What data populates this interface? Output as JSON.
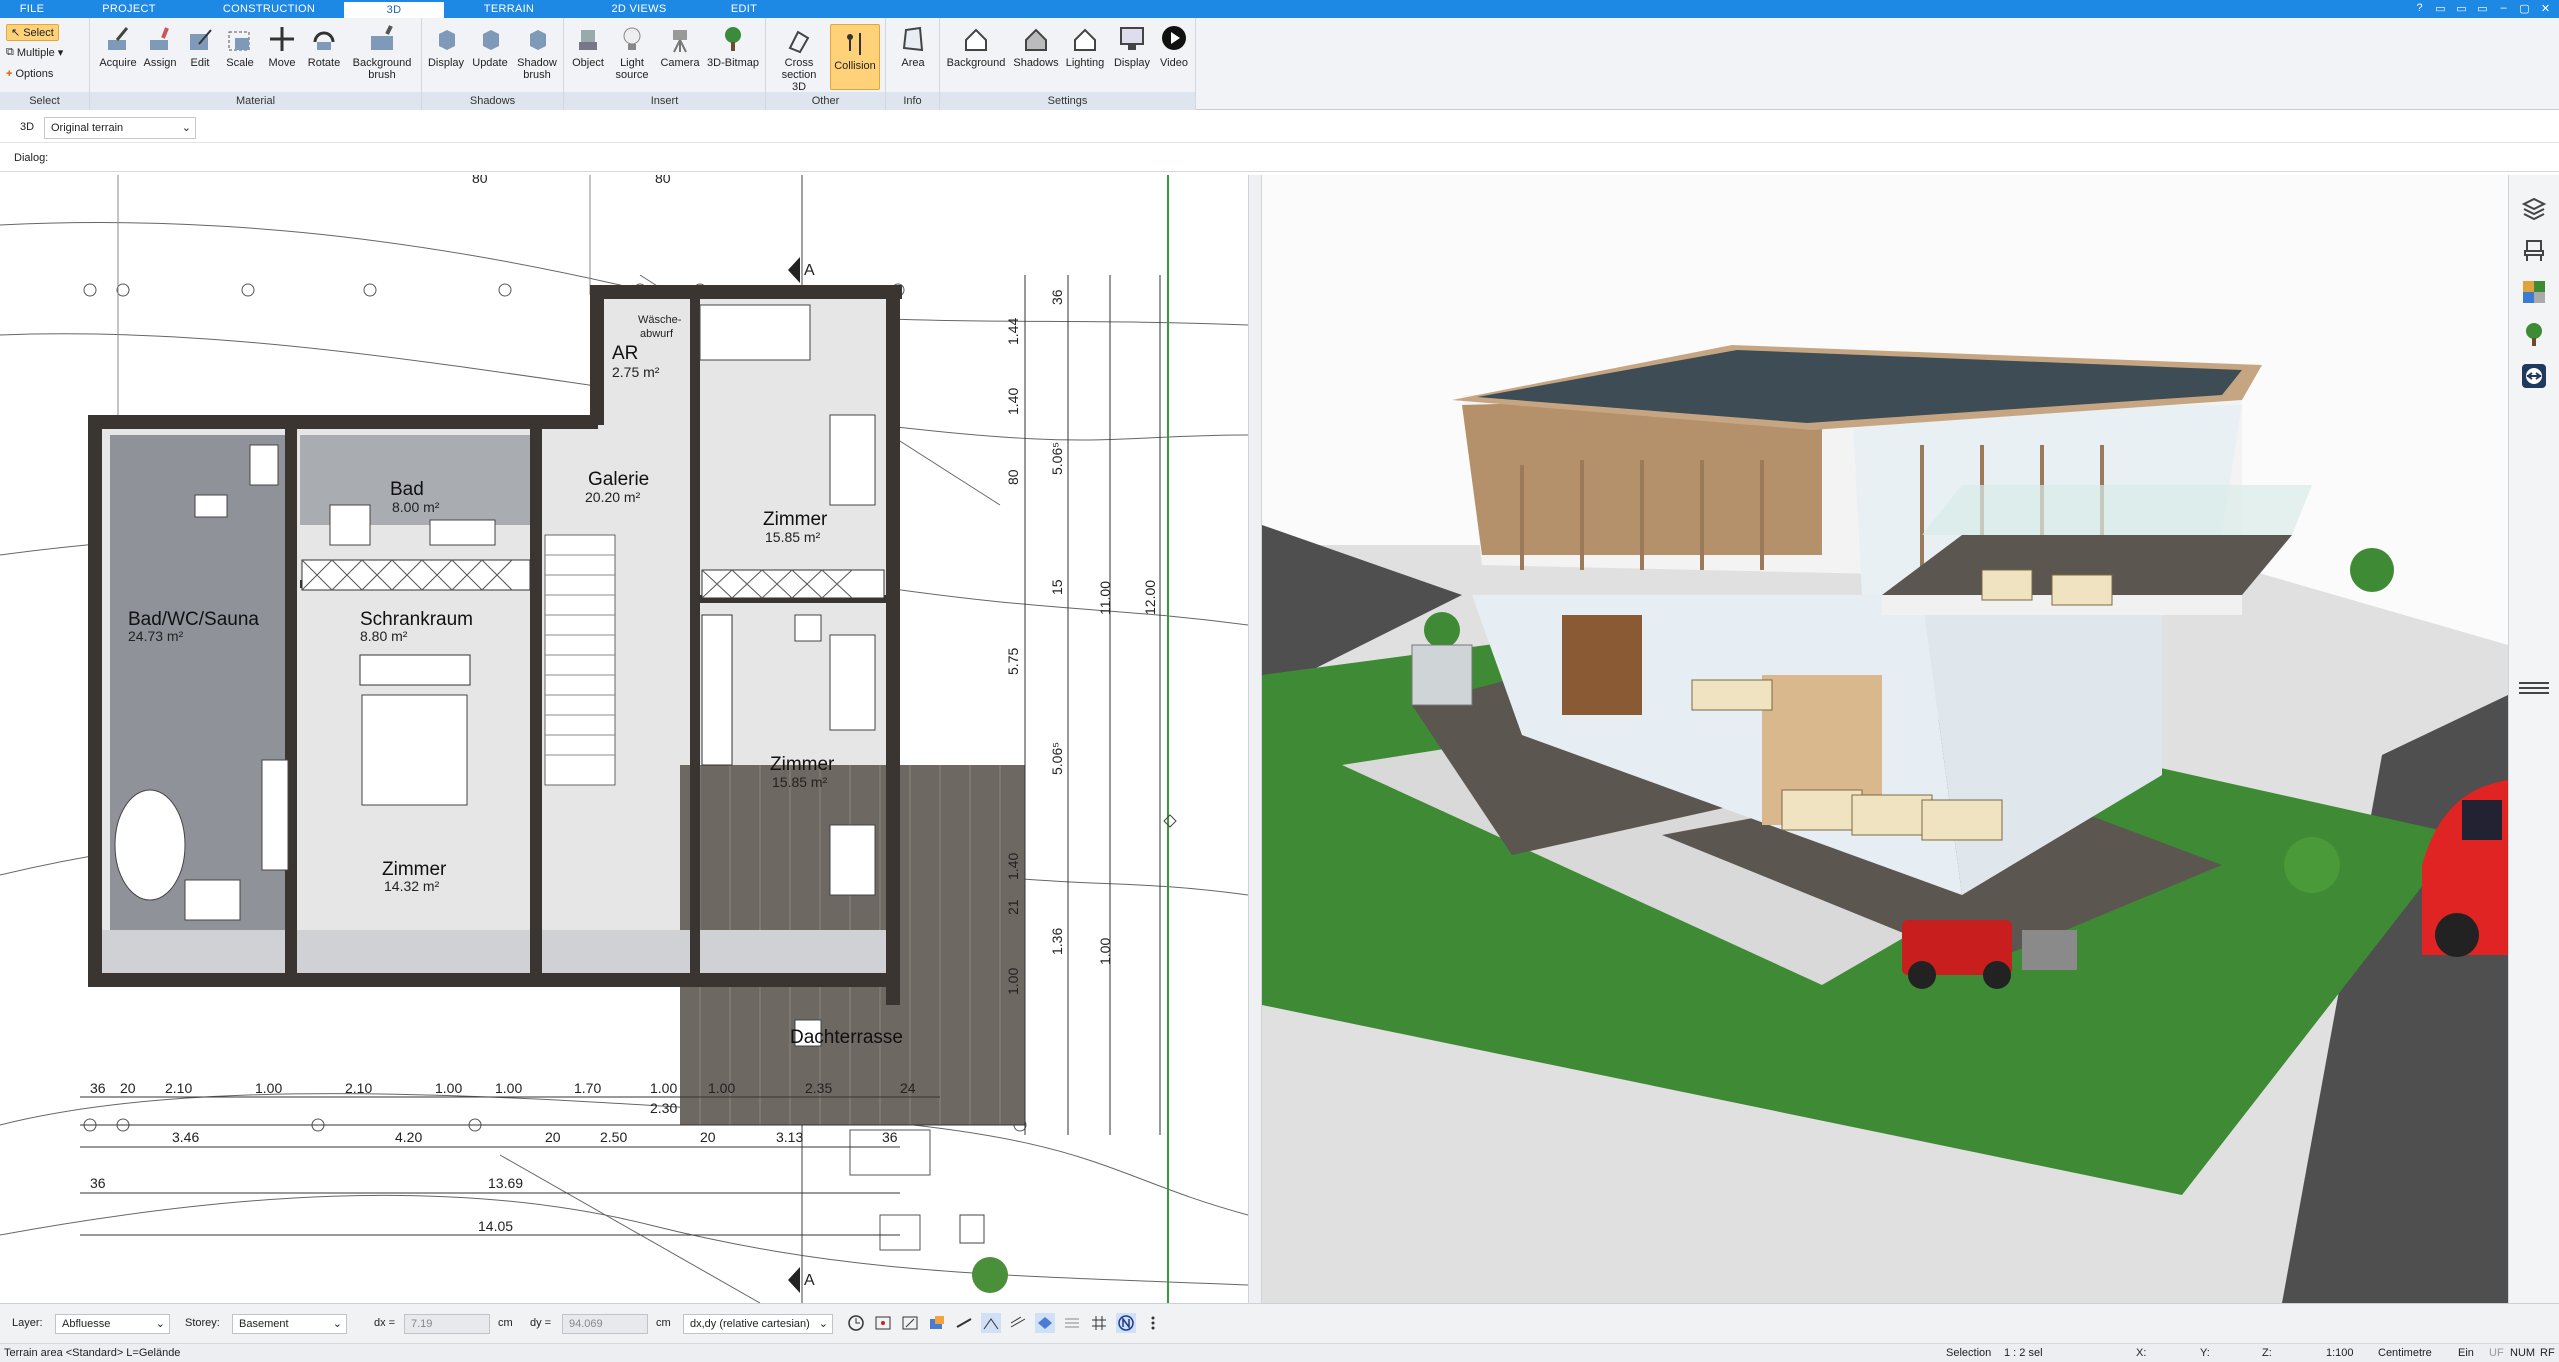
{
  "tabs": [
    "FILE",
    "PROJECT",
    "CONSTRUCTION",
    "3D",
    "TERRAIN",
    "2D VIEWS",
    "EDIT"
  ],
  "active_tab": "3D",
  "window_controls": [
    "?",
    "–",
    "▢",
    "✕"
  ],
  "ribbon": {
    "select": {
      "select": "Select",
      "multiple": "Multiple",
      "options": "Options",
      "title": "Select"
    },
    "material": {
      "buttons": [
        "Acquire",
        "Assign",
        "Edit",
        "Scale",
        "Move",
        "Rotate",
        "Background brush"
      ],
      "title": "Material"
    },
    "shadows": {
      "buttons": [
        "Display",
        "Update",
        "Shadow brush"
      ],
      "title": "Shadows"
    },
    "insert": {
      "buttons": [
        "Object",
        "Light source",
        "Camera",
        "3D-Bitmap"
      ],
      "title": "Insert"
    },
    "other": {
      "buttons": [
        "Cross section 3D",
        "Collision"
      ],
      "title": "Other"
    },
    "info": {
      "buttons": [
        "Area"
      ],
      "title": "Info"
    },
    "settings": {
      "buttons": [
        "Background",
        "Shadows",
        "Lighting",
        "Display",
        "Video"
      ],
      "title": "Settings"
    }
  },
  "viewbar": {
    "mode": "3D",
    "terrain": "Original terrain"
  },
  "dialog_label": "Dialog:",
  "rooms": [
    {
      "name": "AR",
      "area": "2.75 m²"
    },
    {
      "name": "Wäsche-",
      "area": "abwurf"
    },
    {
      "name": "Bad",
      "area": "8.00 m²"
    },
    {
      "name": "Galerie",
      "area": "20.20 m²"
    },
    {
      "name": "Zimmer",
      "area": "15.85 m²"
    },
    {
      "name": "Bad/WC/Sauna",
      "area": "24.73 m²"
    },
    {
      "name": "Schrankraum",
      "area": "8.80 m²"
    },
    {
      "name": "Zimmer",
      "area": "15.85 m²"
    },
    {
      "name": "Zimmer",
      "area": "14.32 m²"
    },
    {
      "name": "Dachterrasse",
      "area": ""
    }
  ],
  "dims_top": [
    "80",
    "80"
  ],
  "dims_row1": [
    "36",
    "20",
    "2.10",
    "1.00",
    "2.10",
    "1.00",
    "1.00",
    "1.70",
    "1.00",
    "1.00",
    "2.35",
    "24"
  ],
  "dims_row1b": "2.30",
  "dims_row2": [
    "3.46",
    "4.20",
    "20",
    "2.50",
    "20",
    "3.13",
    "36"
  ],
  "dims_row3": [
    "36",
    "13.69"
  ],
  "dims_row4": "14.05",
  "dims_right": [
    "36",
    "1.44",
    "1.40",
    "80",
    "5.06⁵",
    "15",
    "5.75",
    "5.06⁵",
    "1.40",
    "21",
    "1.36",
    "1.00",
    "11.00",
    "1.00",
    "12.00"
  ],
  "section_marks": [
    "A",
    "A"
  ],
  "status": {
    "layer_label": "Layer:",
    "layer": "Abfluesse",
    "storey_label": "Storey:",
    "storey": "Basement",
    "dx_label": "dx =",
    "dx": "7.19",
    "dx_unit": "cm",
    "dy_label": "dy =",
    "dy": "94.069",
    "dy_unit": "cm",
    "coord_mode": "dx,dy (relative cartesian)"
  },
  "footer": {
    "left": "Terrain area <Standard> L=Gelände",
    "selection_label": "Selection",
    "selection": "1 : 2 sel",
    "x": "X:",
    "y": "Y:",
    "z": "Z:",
    "scale": "1:100",
    "unit": "Centimetre",
    "ein": "Ein",
    "uf": "UF",
    "num": "NUM",
    "rf": "RF"
  },
  "colors": {
    "accent": "#1e88e5",
    "grass": "#3f8a35",
    "road": "#4f4f4f",
    "deck": "#5c5650",
    "wood": "#b5916b",
    "car": "#e02424",
    "active": "#ffd27a"
  }
}
